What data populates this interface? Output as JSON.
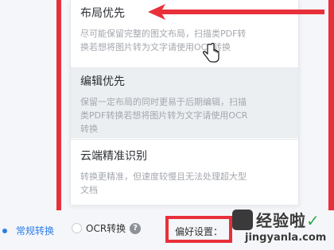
{
  "options": [
    {
      "title": "布局优先",
      "desc_lines": [
        "尽可能保留完整的图文布局，扫描类PDF转",
        "换若想将图片转为文字请使用OCR转换"
      ]
    },
    {
      "title": "编辑优先",
      "desc_lines": [
        "保留一定布局的同时更易于后期编辑，扫描",
        "类PDF转换若想将图片转为文字请使用OCR",
        "转换"
      ]
    },
    {
      "title": "云端精准识别",
      "desc_lines": [
        "转换更精准，但速度较慢且无法处理超大型",
        "文档"
      ]
    }
  ],
  "bottom": {
    "normal_mode": "常规转换",
    "ocr_mode": "OCR转换",
    "help": "?",
    "preference": "偏好设置："
  },
  "watermark": {
    "title": "经验啦",
    "check": "✓",
    "url": "jingyanla.com"
  },
  "colors": {
    "accent": "#2b7de9",
    "annotation": "#e8303a"
  }
}
